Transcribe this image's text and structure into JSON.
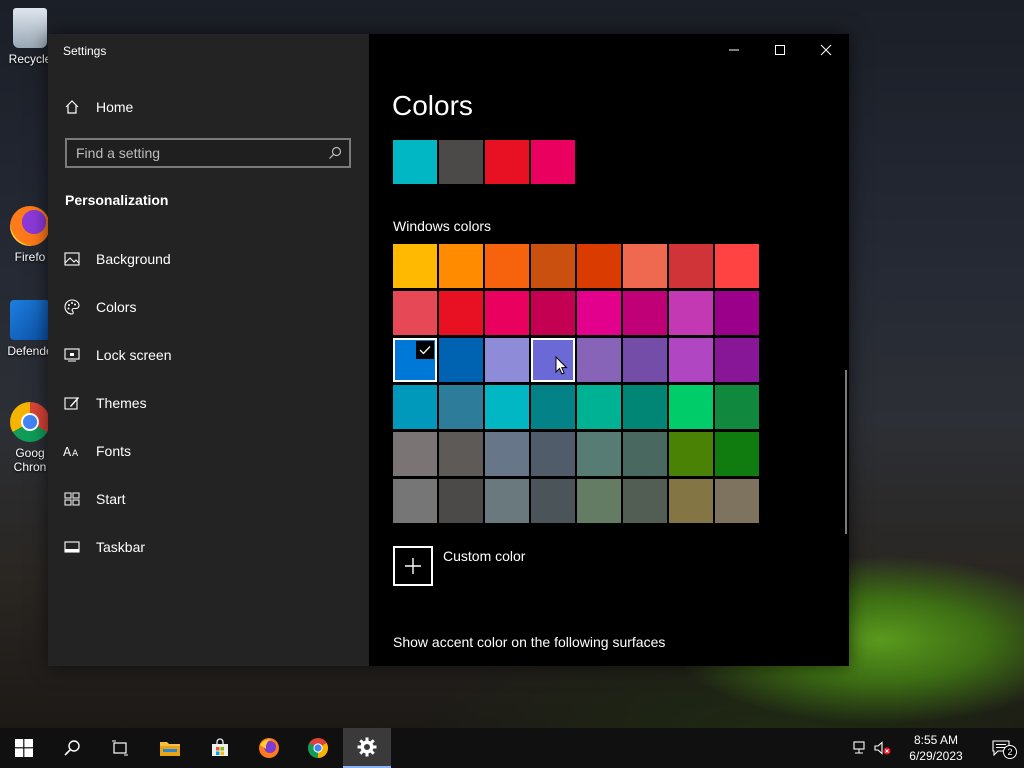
{
  "desktop": {
    "icons": [
      {
        "label": "Recycle"
      },
      {
        "label": "Firefo"
      },
      {
        "label": "Defende"
      },
      {
        "label": "Goog\nChron"
      }
    ]
  },
  "window": {
    "title": "Settings",
    "sidebar": {
      "home_label": "Home",
      "search_placeholder": "Find a setting",
      "section_heading": "Personalization",
      "items": [
        {
          "label": "Background",
          "icon": "picture-icon"
        },
        {
          "label": "Colors",
          "icon": "palette-icon"
        },
        {
          "label": "Lock screen",
          "icon": "lock-screen-icon"
        },
        {
          "label": "Themes",
          "icon": "brush-icon"
        },
        {
          "label": "Fonts",
          "icon": "font-icon"
        },
        {
          "label": "Start",
          "icon": "start-icon"
        },
        {
          "label": "Taskbar",
          "icon": "taskbar-icon"
        }
      ]
    },
    "main": {
      "page_title": "Colors",
      "recent_colors": [
        "#00b7c3",
        "#4c4a48",
        "#e81123",
        "#ea005e"
      ],
      "windows_colors_label": "Windows colors",
      "windows_colors": [
        [
          "#ffb900",
          "#ff8c00",
          "#f7630c",
          "#ca5010",
          "#da3b01",
          "#ef6950",
          "#d13438",
          "#ff4343"
        ],
        [
          "#e74856",
          "#e81123",
          "#ea005e",
          "#c30052",
          "#e3008c",
          "#bf0077",
          "#c239b3",
          "#9a0089"
        ],
        [
          "#0078d7",
          "#0063b1",
          "#8e8cd8",
          "#6b69d6",
          "#8764b8",
          "#744da9",
          "#b146c2",
          "#881798"
        ],
        [
          "#0099bc",
          "#2d7d9a",
          "#00b7c3",
          "#038387",
          "#00b294",
          "#018574",
          "#00cc6a",
          "#10893e"
        ],
        [
          "#7a7574",
          "#5d5a58",
          "#68768a",
          "#515c6b",
          "#567c73",
          "#486860",
          "#498205",
          "#107c10"
        ],
        [
          "#767676",
          "#4c4a48",
          "#69797e",
          "#4a5459",
          "#647c64",
          "#525e54",
          "#847545",
          "#7e735f"
        ]
      ],
      "selected_color": "#0078d7",
      "hovered_color": "#6b69d6",
      "custom_color_label": "Custom color",
      "accent_surfaces_label": "Show accent color on the following surfaces"
    }
  },
  "taskbar": {
    "time": "8:55 AM",
    "date": "6/29/2023",
    "notification_count": "2"
  }
}
